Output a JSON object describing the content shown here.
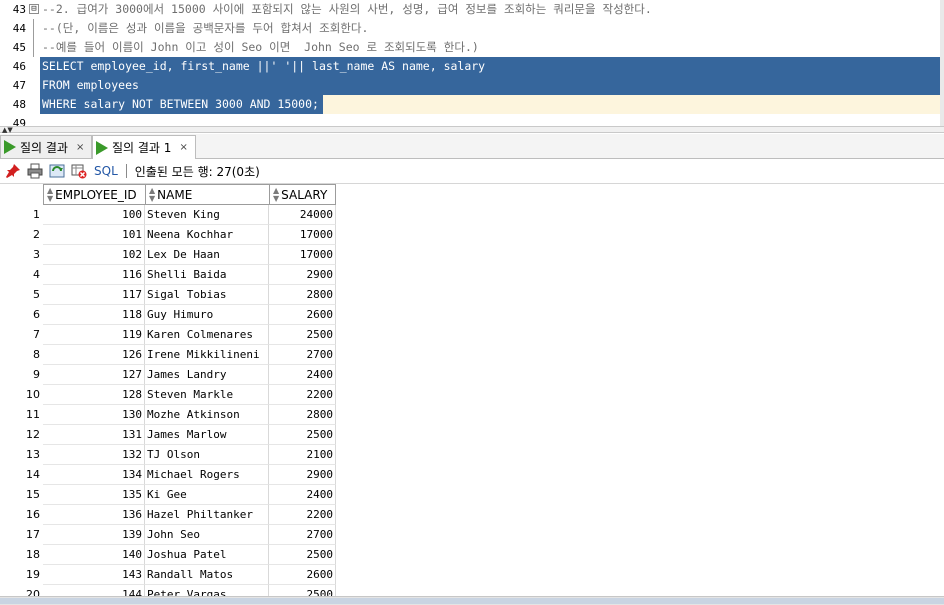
{
  "editor": {
    "lines": [
      {
        "num": "43",
        "text": "--2. 급여가 3000에서 15000 사이에 포함되지 않는 사원의 사번, 성명, 급여 정보를 조회하는 쿼리문을 작성한다.",
        "kind": "comment",
        "fold": "⊟"
      },
      {
        "num": "44",
        "text": "--(단, 이름은 성과 이름을 공백문자를 두어 합쳐서 조회한다.",
        "kind": "comment"
      },
      {
        "num": "45",
        "text": "--예를 들어 이름이 John 이고 성이 Seo 이면  John Seo 로 조회되도록 한다.)",
        "kind": "comment"
      },
      {
        "num": "46",
        "text": "SELECT employee_id, first_name ||' '|| last_name AS name, salary",
        "kind": "selected"
      },
      {
        "num": "47",
        "text": "FROM employees",
        "kind": "selected"
      },
      {
        "num": "48",
        "text": "WHERE salary NOT BETWEEN 3000 AND 15000;",
        "kind": "selected-partial"
      },
      {
        "num": "49",
        "text": "",
        "kind": "plain"
      }
    ]
  },
  "tabs": [
    {
      "label": "질의 결과",
      "close": "×"
    },
    {
      "label": "질의 결과 1",
      "close": "×"
    }
  ],
  "toolbar": {
    "sql_label": "SQL",
    "status": "인출된 모든 행: 27(0초)"
  },
  "grid": {
    "columns": [
      "EMPLOYEE_ID",
      "NAME",
      "SALARY"
    ],
    "rows": [
      [
        "1",
        "100",
        "Steven King",
        "24000"
      ],
      [
        "2",
        "101",
        "Neena Kochhar",
        "17000"
      ],
      [
        "3",
        "102",
        "Lex De Haan",
        "17000"
      ],
      [
        "4",
        "116",
        "Shelli Baida",
        "2900"
      ],
      [
        "5",
        "117",
        "Sigal Tobias",
        "2800"
      ],
      [
        "6",
        "118",
        "Guy Himuro",
        "2600"
      ],
      [
        "7",
        "119",
        "Karen Colmenares",
        "2500"
      ],
      [
        "8",
        "126",
        "Irene Mikkilineni",
        "2700"
      ],
      [
        "9",
        "127",
        "James Landry",
        "2400"
      ],
      [
        "10",
        "128",
        "Steven Markle",
        "2200"
      ],
      [
        "11",
        "130",
        "Mozhe Atkinson",
        "2800"
      ],
      [
        "12",
        "131",
        "James Marlow",
        "2500"
      ],
      [
        "13",
        "132",
        "TJ Olson",
        "2100"
      ],
      [
        "14",
        "134",
        "Michael Rogers",
        "2900"
      ],
      [
        "15",
        "135",
        "Ki Gee",
        "2400"
      ],
      [
        "16",
        "136",
        "Hazel Philtanker",
        "2200"
      ],
      [
        "17",
        "139",
        "John Seo",
        "2700"
      ],
      [
        "18",
        "140",
        "Joshua Patel",
        "2500"
      ],
      [
        "19",
        "143",
        "Randall Matos",
        "2600"
      ],
      [
        "20",
        "144",
        "Peter Vargas",
        "2500"
      ]
    ]
  },
  "icons": [
    "pin-icon",
    "print-icon",
    "refresh-icon",
    "delete-grid-icon",
    "run-icon",
    "sort-icon"
  ],
  "colors": {
    "selection": "#36669c",
    "current_line": "#fdf5dd",
    "run_green": "#3a9a2a",
    "sql_blue": "#2357a6"
  }
}
